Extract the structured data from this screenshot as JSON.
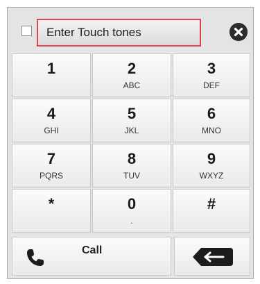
{
  "input": {
    "placeholder": "Enter Touch tones",
    "value": ""
  },
  "checkbox": {
    "checked": false
  },
  "icons": {
    "close": "close-icon",
    "call": "phone-icon",
    "backspace": "backspace-icon"
  },
  "keys": [
    {
      "digit": "1",
      "letters": ""
    },
    {
      "digit": "2",
      "letters": "ABC"
    },
    {
      "digit": "3",
      "letters": "DEF"
    },
    {
      "digit": "4",
      "letters": "GHI"
    },
    {
      "digit": "5",
      "letters": "JKL"
    },
    {
      "digit": "6",
      "letters": "MNO"
    },
    {
      "digit": "7",
      "letters": "PQRS"
    },
    {
      "digit": "8",
      "letters": "TUV"
    },
    {
      "digit": "9",
      "letters": "WXYZ"
    },
    {
      "digit": "*",
      "letters": ""
    },
    {
      "digit": "0",
      "letters": "."
    },
    {
      "digit": "#",
      "letters": ""
    }
  ],
  "call": {
    "label": "Call"
  },
  "colors": {
    "input_border": "#d9464c",
    "panel": "#e4e4e4",
    "icon_dark": "#2c2c2c"
  }
}
